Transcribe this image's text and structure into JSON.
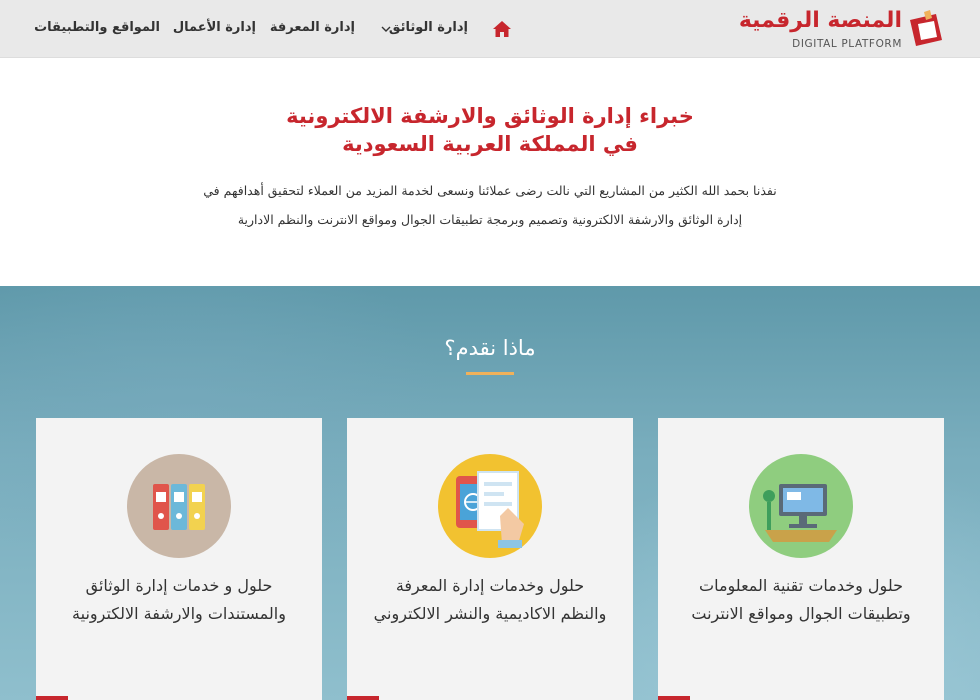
{
  "brand": {
    "name_ar": "المنصة الرقمية",
    "name_en": "DIGITAL PLATFORM",
    "accent_color": "#c7262d"
  },
  "nav": {
    "home_icon": "home-icon",
    "items": [
      {
        "label": "إدارة الوثائق",
        "has_dropdown": true
      },
      {
        "label": "إدارة المعرفة"
      },
      {
        "label": "إدارة الأعمال"
      },
      {
        "label": "المواقع والتطبيقات"
      }
    ]
  },
  "intro": {
    "title_line1": "خبراء إدارة الوثائق والارشفة الالكترونية",
    "title_line2": "في المملكة العربية السعودية",
    "text_line1": "نفذنا بحمد الله الكثير من المشاريع التي نالت رضى عملائنا ونسعى لخدمة المزيد من العملاء لتحقيق أهدافهم في",
    "text_line2": "إدارة الوثائق والارشفة الالكترونية وتصميم وبرمجة تطبيقات الجوال ومواقع الانترنت والنظم الادارية"
  },
  "services": {
    "title": "ماذا نقدم؟",
    "cards": [
      {
        "icon": "it-services-icon",
        "line1": "حلول وخدمات تقنية المعلومات",
        "line2": "وتطبيقات الجوال ومواقع الانترنت"
      },
      {
        "icon": "knowledge-management-icon",
        "line1": "حلول وخدمات إدارة المعرفة",
        "line2": "والنظم الاكاديمية والنشر الالكتروني"
      },
      {
        "icon": "document-binders-icon",
        "line1": "حلول و خدمات إدارة الوثائق",
        "line2": "والمستندات والارشفة الالكترونية"
      }
    ]
  }
}
